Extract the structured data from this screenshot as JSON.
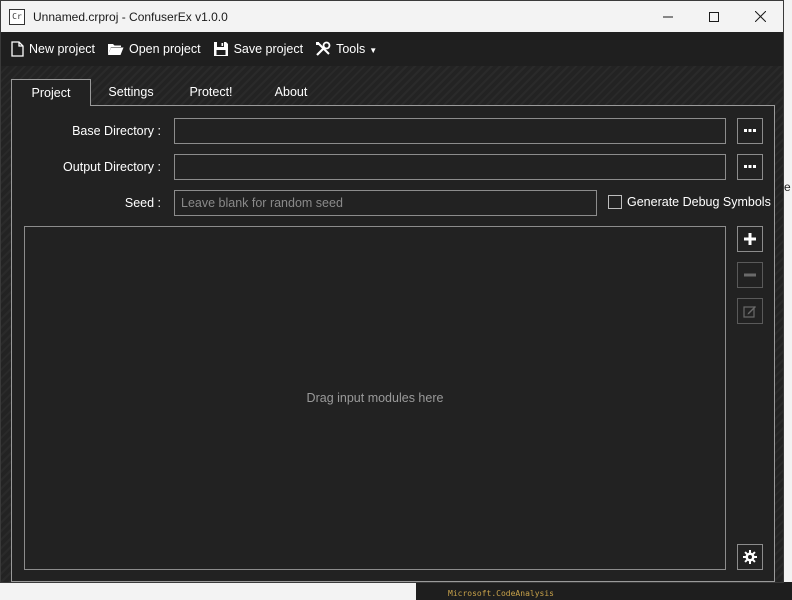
{
  "window": {
    "title": "Unnamed.crproj - ConfuserEx v1.0.0",
    "icon_text": "Cr",
    "controls": [
      "minimize",
      "maximize",
      "close"
    ]
  },
  "toolbar": {
    "new_project": "New project",
    "open_project": "Open project",
    "save_project": "Save project",
    "tools": "Tools"
  },
  "tabs": [
    {
      "label": "Project",
      "active": true
    },
    {
      "label": "Settings",
      "active": false
    },
    {
      "label": "Protect!",
      "active": false
    },
    {
      "label": "About",
      "active": false
    }
  ],
  "project": {
    "base_directory_label": "Base Directory :",
    "base_directory_value": "",
    "output_directory_label": "Output Directory :",
    "output_directory_value": "",
    "seed_label": "Seed :",
    "seed_value": "",
    "seed_placeholder": "Leave blank for random seed",
    "debug_symbols_label": "Generate Debug Symbols",
    "debug_symbols_checked": false,
    "browse_label": "...",
    "drop_hint": "Drag input modules here"
  },
  "background": {
    "right_peek_text": "e",
    "bottom_text": "Microsoft.CodeAnalysis"
  },
  "colors": {
    "window_bg": "#2b2b2b",
    "titlebar_bg": "#f3f3f3",
    "menubar_bg": "#1f1f1f",
    "border": "#8c8c8c",
    "text": "#ffffff",
    "hint_text": "#9a9a9a"
  }
}
